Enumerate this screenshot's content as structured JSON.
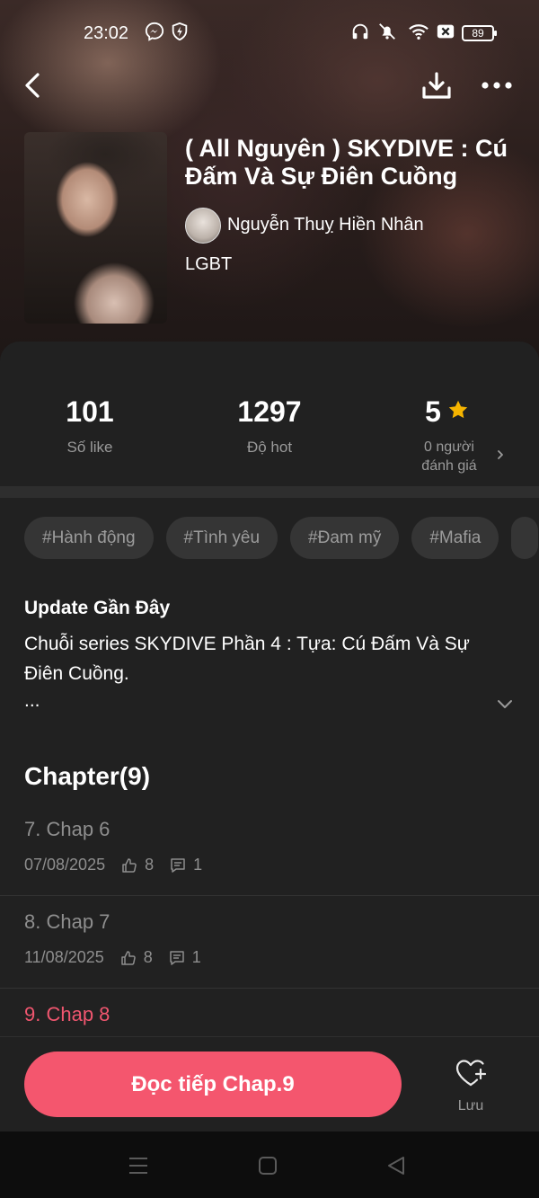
{
  "status_bar": {
    "time": "23:02",
    "left_icons": [
      "messenger-icon",
      "shield-icon"
    ],
    "right_icons": [
      "headphones-icon",
      "mute-icon",
      "wifi-icon",
      "sim-off-icon"
    ],
    "battery": "89"
  },
  "top_nav": {
    "back_icon": "chevron-left-icon",
    "download_icon": "download-icon",
    "more_icon": "more-icon"
  },
  "story": {
    "title": "( All Nguyên ) SKYDIVE : Cú Đấm Và Sự Điên Cuồng",
    "author": "Nguyễn Thuỵ Hiền Nhân",
    "genre": "LGBT"
  },
  "stats": {
    "likes_value": "101",
    "likes_label": "Số like",
    "hot_value": "1297",
    "hot_label": "Độ hot",
    "rating_value": "5",
    "rating_label_line1": "0 người",
    "rating_label_line2": "đánh giá",
    "star_color": "#f5b400"
  },
  "tags": [
    "#Hành động",
    "#Tình yêu",
    "#Đam mỹ",
    "#Mafia"
  ],
  "update": {
    "title": "Update Gần Đây",
    "body": "Chuỗi series SKYDIVE  Phần 4 : Tựa: Cú Đấm Và Sự Điên Cuồng.",
    "ellipsis": "..."
  },
  "chapters": {
    "heading": "Chapter(9)",
    "items": [
      {
        "title": "7. Chap 6",
        "date": "07/08/2025",
        "likes": "8",
        "comments": "1"
      },
      {
        "title": "8. Chap 7",
        "date": "11/08/2025",
        "likes": "8",
        "comments": "1"
      },
      {
        "title": "9. Chap 8"
      }
    ]
  },
  "actions": {
    "read_label": "Đọc tiếp Chap.9",
    "save_label": "Lưu",
    "accent_color": "#f4566e"
  }
}
